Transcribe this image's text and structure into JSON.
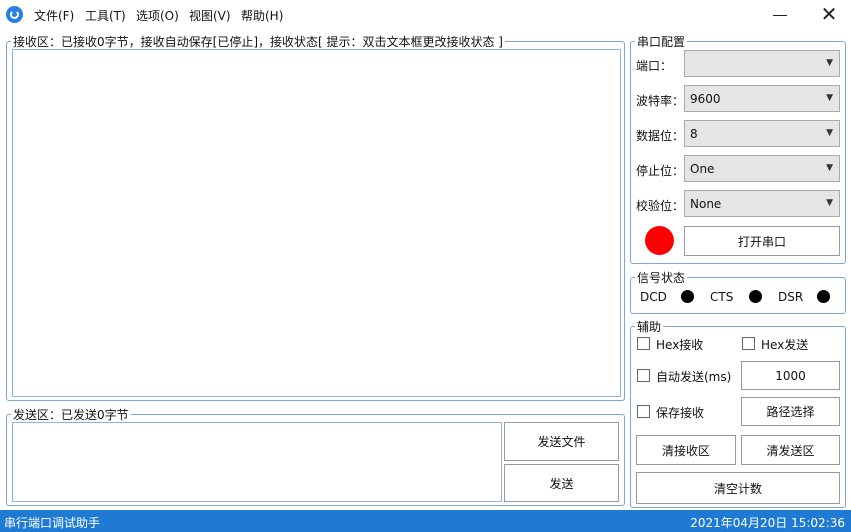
{
  "menu": {
    "items": [
      "文件(F)",
      "工具(T)",
      "选项(O)",
      "视图(V)",
      "帮助(H)"
    ]
  },
  "window": {
    "close_glyph": "✕"
  },
  "receive": {
    "legend": "接收区：已接收0字节，接收自动保存[已停止]，接收状态[ 提示：双击文本框更改接收状态 ]",
    "text": ""
  },
  "send": {
    "legend": "发送区：已发送0字节",
    "text": "",
    "send_file_label": "发送文件",
    "send_label": "发送"
  },
  "port_config": {
    "legend": "串口配置",
    "port_label": "端口：",
    "port_value": "",
    "baud_label": "波特率：",
    "baud_value": "9600",
    "data_bits_label": "数据位：",
    "data_bits_value": "8",
    "stop_bits_label": "停止位：",
    "stop_bits_value": "One",
    "parity_label": "校验位：",
    "parity_value": "None",
    "open_button_label": "打开串口",
    "status_color": "#ff0000"
  },
  "signal": {
    "legend": "信号状态",
    "dcd_label": "DCD",
    "cts_label": "CTS",
    "dsr_label": "DSR"
  },
  "aux": {
    "legend": "辅助",
    "hex_receive_label": "Hex接收",
    "hex_send_label": "Hex发送",
    "auto_send_label": "自动发送(ms)",
    "auto_send_interval": "1000",
    "save_receive_label": "保存接收",
    "path_select_label": "路径选择",
    "clear_receive_label": "清接收区",
    "clear_send_label": "清发送区",
    "clear_count_label": "清空计数"
  },
  "statusbar": {
    "app_name": "串行端口调试助手",
    "datetime": "2021年04月20日 15:02:36"
  },
  "colors": {
    "accent": "#1f7ad3",
    "group_border": "#7aa6d9"
  }
}
